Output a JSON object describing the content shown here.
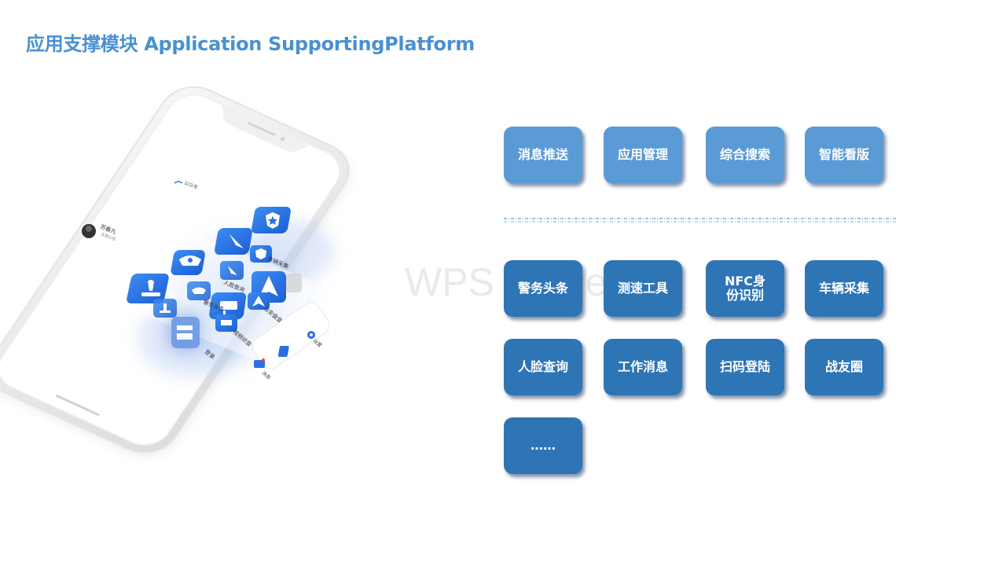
{
  "slide": {
    "title": "应用支撑模块 Application SupportingPlatform",
    "watermark": "WPS Office"
  },
  "phone": {
    "user_name": "苏春凡",
    "user_sub": "主管公告",
    "top_right_label": "公众号",
    "apps": [
      {
        "label": "人脸查询",
        "icon": "face-icon"
      },
      {
        "label": "车辆采集",
        "icon": "car-icon"
      },
      {
        "label": "警务头条",
        "icon": "police-icon"
      },
      {
        "label": "视频侦查",
        "icon": "camera-icon"
      },
      {
        "label": "治安盘查",
        "icon": "navigate-icon"
      },
      {
        "label": "登录",
        "icon": "stamp-icon"
      }
    ],
    "tabbar": [
      {
        "label": "消息",
        "icon": "chat-icon"
      },
      {
        "label": "通讯",
        "icon": "book-icon"
      },
      {
        "label": "设置",
        "icon": "gear-icon"
      }
    ]
  },
  "features": {
    "top_row": [
      {
        "label": "消息推送"
      },
      {
        "label": "应用管理"
      },
      {
        "label": "综合搜索"
      },
      {
        "label": "智能看版"
      }
    ],
    "bottom_rows": [
      [
        {
          "label": "警务头条"
        },
        {
          "label": "测速工具"
        },
        {
          "label": "NFC身份识别"
        },
        {
          "label": "车辆采集"
        }
      ],
      [
        {
          "label": "人脸查询"
        },
        {
          "label": "工作消息"
        },
        {
          "label": "扫码登陆"
        },
        {
          "label": "战友圈"
        }
      ],
      [
        {
          "label": "……"
        }
      ]
    ]
  },
  "colors": {
    "title": "#4a90d2",
    "tile_light": "#5b9bd5",
    "tile_dark": "#2e75b6",
    "app_icon_blue": "#1f6fe0"
  }
}
